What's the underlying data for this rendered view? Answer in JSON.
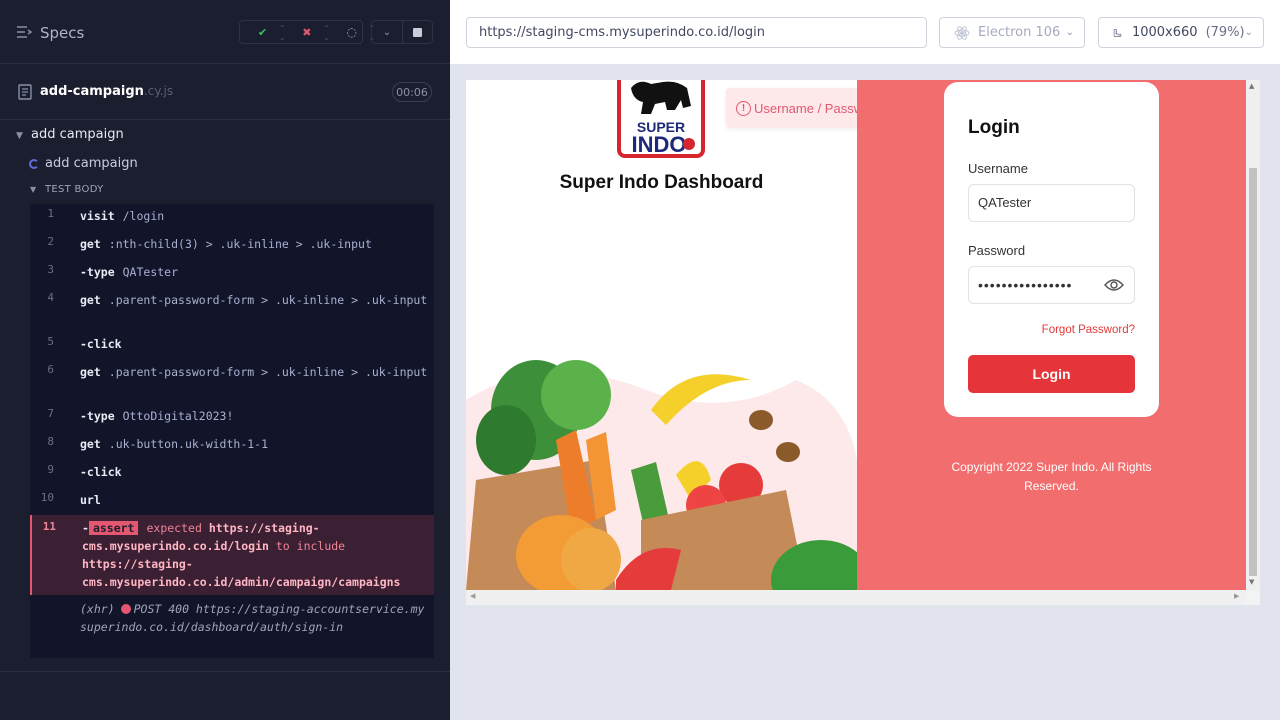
{
  "sidebar": {
    "specs_label": "Specs",
    "stats": {
      "passed": "--",
      "failed": "--",
      "pending": "--"
    },
    "file": {
      "name": "add-campaign",
      "ext": ".cy.js",
      "duration": "00:06"
    },
    "suite_title": "add campaign",
    "test_title": "add campaign",
    "body_label": "TEST BODY",
    "commands": [
      {
        "num": "1",
        "name": "visit",
        "arg": "/login"
      },
      {
        "num": "2",
        "name": "get",
        "arg": ":nth-child(3) > .uk-inline > .uk-input"
      },
      {
        "num": "3",
        "name": "-type",
        "arg": "QATester"
      },
      {
        "num": "4",
        "name": "get",
        "arg": ".parent-password-form > .uk-inline > .uk-input"
      },
      {
        "num": "5",
        "name": "-click",
        "arg": ""
      },
      {
        "num": "6",
        "name": "get",
        "arg": ".parent-password-form > .uk-inline > .uk-input"
      },
      {
        "num": "7",
        "name": "-type",
        "arg": "OttoDigital2023!"
      },
      {
        "num": "8",
        "name": "get",
        "arg": ".uk-button.uk-width-1-1"
      },
      {
        "num": "9",
        "name": "-click",
        "arg": ""
      },
      {
        "num": "10",
        "name": "url",
        "arg": ""
      }
    ],
    "assert": {
      "num": "11",
      "pill": "assert",
      "w1": "expected",
      "v1": "https://staging-cms.mysuperindo.co.id/login",
      "w2": "to include",
      "v2": "https://staging-cms.mysuperindo.co.id/admin/campaign/campaigns"
    },
    "xhr": {
      "label": "(xhr)",
      "text": "POST 400 https://staging-accountservice.mysuperindo.co.id/dashboard/auth/sign-in"
    }
  },
  "browser": {
    "url": "https://staging-cms.mysuperindo.co.id/login",
    "name": "Electron 106",
    "viewport": "1000x660",
    "zoom": "(79%)"
  },
  "app": {
    "logo_text_1": "SUPER",
    "logo_text_2": "INDO",
    "dashboard_title": "Super Indo Dashboard",
    "toast": "Username / Password is incorrect",
    "login_title": "Login",
    "username_label": "Username",
    "username_value": "QATester",
    "password_label": "Password",
    "password_value": "••••••••••••••••",
    "forgot": "Forgot Password?",
    "login_button": "Login",
    "copyright": "Copyright 2022 Super Indo. All Rights Reserved."
  },
  "colors": {
    "accent_red": "#e5343a",
    "panel_red": "#f26d6d",
    "fail_pink": "#e45770"
  }
}
